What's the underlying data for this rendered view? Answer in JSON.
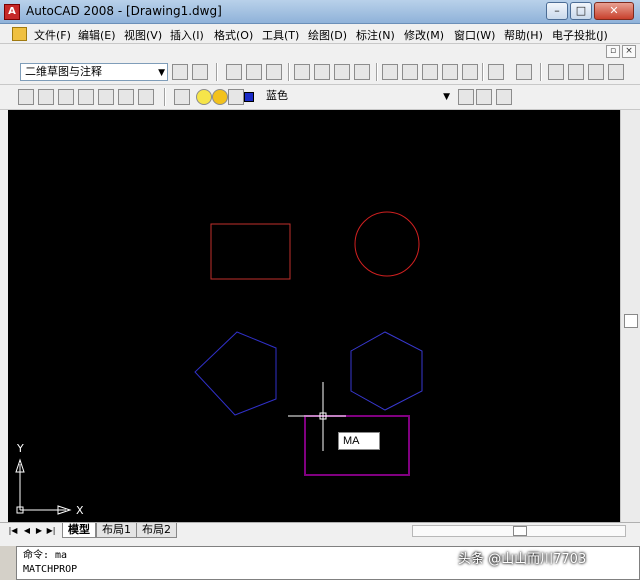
{
  "window": {
    "title": "AutoCAD 2008 - [Drawing1.dwg]",
    "app_icon_letter": "A",
    "minimize_label": "–",
    "maximize_label": "□",
    "close_label": "✕"
  },
  "menu": {
    "items": [
      "文件(F)",
      "编辑(E)",
      "视图(V)",
      "插入(I)",
      "格式(O)",
      "工具(T)",
      "绘图(D)",
      "标注(N)",
      "修改(M)",
      "窗口(W)",
      "帮助(H)",
      "电子投批(J)"
    ]
  },
  "mdi": {
    "restore_label": "▫",
    "close_label": "×"
  },
  "toolbar": {
    "workspace": "二维草图与注释",
    "layer_name": "蓝色"
  },
  "canvas": {
    "tooltip_text": "MA",
    "ucs_x_label": "X",
    "ucs_y_label": "Y",
    "colors": {
      "background": "#000000",
      "rectangle": "#c0302c",
      "circle": "#d02020",
      "pentagon": "#3030c8",
      "hexagon": "#3838d0",
      "selection_box": "#800080",
      "crosshair": "#ffffff"
    }
  },
  "tabs": {
    "items": [
      "模型",
      "布局1",
      "布局2"
    ],
    "active": "模型"
  },
  "command": {
    "lines": [
      "命令: ma",
      "MATCHPROP"
    ]
  },
  "watermark": "头条 @山山而川7703"
}
